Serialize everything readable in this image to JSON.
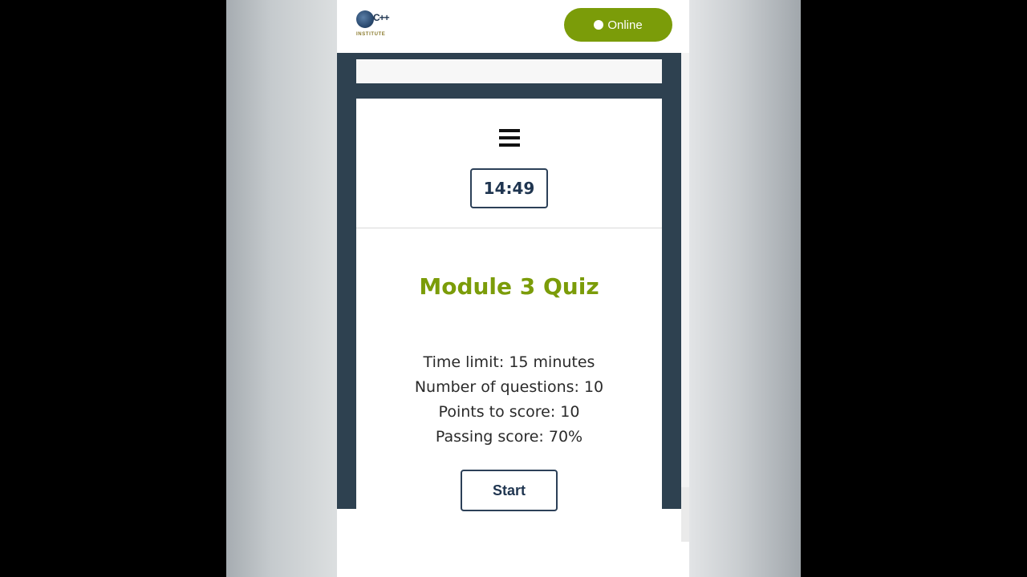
{
  "header": {
    "logo": {
      "mark": "C++",
      "text": "INSTITUTE"
    },
    "status_button": {
      "label": "Online",
      "color": "#7b9c09"
    }
  },
  "quiz": {
    "timer": "14:49",
    "title": "Module 3 Quiz",
    "details": [
      "Time limit: 15 minutes",
      "Number of questions: 10",
      "Points to score: 10",
      "Passing score: 70%"
    ],
    "start_label": "Start"
  },
  "colors": {
    "accent_green": "#7b9c09",
    "frame_dark": "#2e4150",
    "button_border": "#2c4058"
  },
  "icons": {
    "menu": "hamburger-menu-icon",
    "status": "status-dot-icon"
  }
}
